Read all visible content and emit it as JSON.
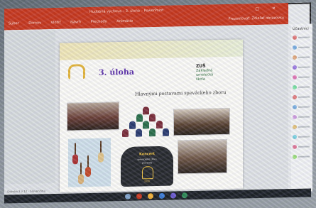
{
  "window": {
    "title": "Hudobná výchova – 3. úloha – PowerPoint",
    "ribbon_tabs": [
      "Súbor",
      "Domov",
      "Vložiť",
      "Návrh",
      "Prechody",
      "Animácie"
    ],
    "present_label": "Prezentovať",
    "share_label": "Zdieľať obrazovku",
    "controls": "– ▢ ✕"
  },
  "slide": {
    "heading": "3. úloha",
    "subheading": "Hlavnými postavami speváckeho zboru",
    "logo_line1": "ZUŠ",
    "logo_line2": "Základná umelecká",
    "logo_line3": "škola",
    "poster_title": "Koncert",
    "poster_sub1": "speváckeho zboru",
    "poster_sub2": "pozvánka",
    "poster_date": "2020"
  },
  "participants_panel": {
    "title": "Účastníci"
  },
  "status_bar": {
    "text": "Snímka 3 z 12 · Slovenčina"
  },
  "colors": {
    "titlebar": "#c7391f",
    "heading": "#5a2fa8",
    "poster_text": "#f4c642"
  },
  "icons": [
    "bell-icon",
    "guitar-icon",
    "conductor-icon",
    "participant-avatar-icon",
    "taskbar-app-icon"
  ]
}
